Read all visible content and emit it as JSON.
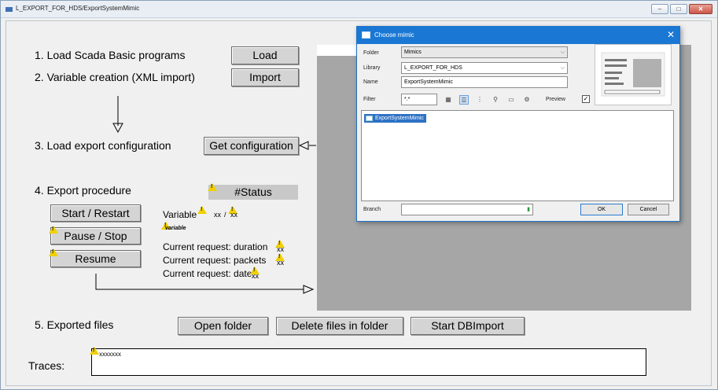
{
  "window": {
    "title": "L_EXPORT_FOR_HDS/ExportSystemMimic",
    "min": "–",
    "max": "□",
    "close": "✕"
  },
  "steps": {
    "s1": "1. Load Scada Basic programs",
    "s2": "2. Variable creation (XML import)",
    "s3": "3. Load export configuration",
    "s4": "4. Export procedure",
    "s5": "5. Exported files"
  },
  "buttons": {
    "load": "Load",
    "import": "Import",
    "get_config": "Get configuration",
    "start_restart": "Start / Restart",
    "pause_stop": "Pause / Stop",
    "resume": "Resume",
    "open_folder": "Open folder",
    "delete_files": "Delete files in folder",
    "start_dbimport": "Start DBImport"
  },
  "status": {
    "label": "#Status"
  },
  "variable": {
    "label": "Variable",
    "value": "xx",
    "max": "xx",
    "sub": "variable"
  },
  "requests": {
    "duration": "Current request: duration",
    "packets": "Current request: packets",
    "date": "Current request: date",
    "placeholder": "xx"
  },
  "traces": {
    "label": "Traces:",
    "value": "xxxxxxx"
  },
  "dialog": {
    "title": "Choose mimic",
    "close": "✕",
    "folder_label": "Folder",
    "folder_value": "Mimics",
    "library_label": "Library",
    "library_value": "L_EXPORT_FOR_HDS",
    "name_label": "Name",
    "name_value": "ExportSystemMimic",
    "filter_label": "Filter",
    "filter_value": "*.*",
    "preview_label": "Preview",
    "preview_checked": "✓",
    "list_items": [
      "ExportSystemMimic"
    ],
    "branch_label": "Branch",
    "ok": "OK",
    "cancel": "Cancel"
  },
  "icons": [
    "warning-icon",
    "list-view-icon",
    "details-view-icon",
    "tree-view-icon",
    "search-icon",
    "folder-icon",
    "settings-icon"
  ]
}
